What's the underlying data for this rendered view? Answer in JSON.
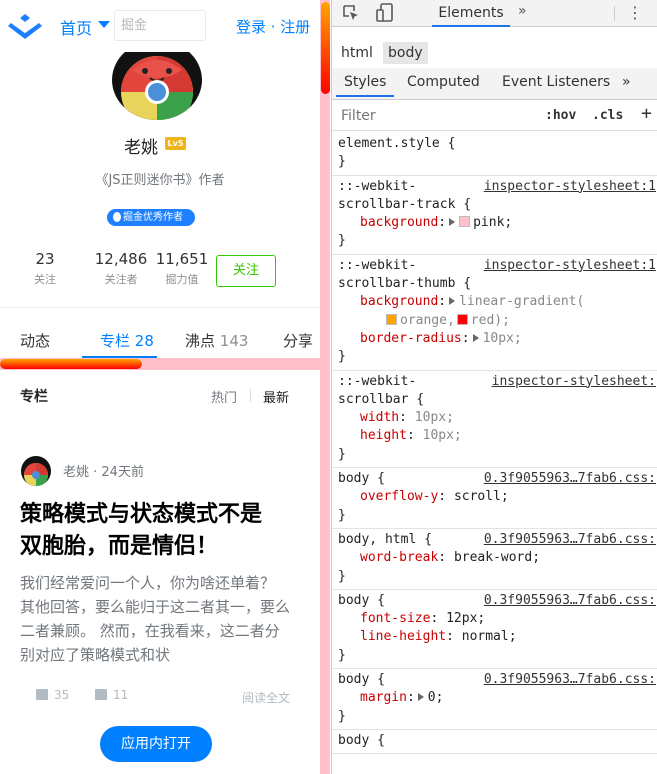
{
  "header": {
    "home_label": "首页",
    "search_placeholder": "掘金",
    "login_label": "登录 · 注册"
  },
  "profile": {
    "username": "老姚",
    "level": "Lv5",
    "bio": "《JS正则迷你书》作者",
    "badge": "掘金优秀作者",
    "stats": [
      {
        "number": "23",
        "label": "关注"
      },
      {
        "number": "12,486",
        "label": "关注者"
      },
      {
        "number": "11,651",
        "label": "掘力值"
      }
    ],
    "follow_label": "关注"
  },
  "tabs": [
    {
      "label": "动态",
      "count": ""
    },
    {
      "label": "专栏",
      "count": "28"
    },
    {
      "label": "沸点",
      "count": "143"
    },
    {
      "label": "分享",
      "count": ""
    }
  ],
  "section": {
    "title": "专栏",
    "sort_hot": "热门",
    "sort_new": "最新"
  },
  "article": {
    "author_meta": "老姚 · 24天前",
    "title": "策略模式与状态模式不是双胞胎，而是情侣！",
    "summary": "我们经常爱问一个人，你为啥还单着？ 其他回答，要么能归于这二者其一，要么二者兼顾。 然而，在我看来，这二者分别对应了策略模式和状",
    "likes": "35",
    "comments": "11",
    "read_more": "阅读全文",
    "open_app": "应用内打开"
  },
  "devtools": {
    "main_tab": "Elements",
    "more": "»",
    "menu": "⋮",
    "breadcrumbs": [
      "html",
      "body"
    ],
    "subtabs": [
      "Styles",
      "Computed",
      "Event Listeners",
      "»"
    ],
    "filter_placeholder": "Filter",
    "hov": ":hov",
    "cls": ".cls",
    "plus": "+",
    "rules": {
      "r0": {
        "sel1": "element.style {",
        "close": "}"
      },
      "r1": {
        "sel1": "::-webkit-",
        "sel2": "scrollbar-track {",
        "src": "inspector-stylesheet:1",
        "p1n": "background",
        "p1v": "pink;",
        "close": "}"
      },
      "r2": {
        "sel1": "::-webkit-",
        "sel2": "scrollbar-thumb {",
        "src": "inspector-stylesheet:1",
        "p1n": "background",
        "p1v": "linear-gradient(",
        "p1c1": "orange,",
        "p1c2": "red);",
        "p2n": "border-radius",
        "p2v": "10px;",
        "close": "}"
      },
      "r3": {
        "sel1": "::-webkit-",
        "sel2": "scrollbar {",
        "src": "inspector-stylesheet:",
        "p1n": "width",
        "p1v": "10px;",
        "p2n": "height",
        "p2v": "10px;",
        "close": "}"
      },
      "r4": {
        "sel1": "body {",
        "src": "0.3f9055963…7fab6.css:",
        "p1n": "overflow-y",
        "p1v": "scroll;",
        "close": "}"
      },
      "r5": {
        "sel1": "body, html {",
        "src": "0.3f9055963…7fab6.css:",
        "p1n": "word-break",
        "p1v": "break-word;",
        "close": "}"
      },
      "r6": {
        "sel1": "body {",
        "src": "0.3f9055963…7fab6.css:",
        "p1n": "font-size",
        "p1v": "12px;",
        "p2n": "line-height",
        "p2v": "normal;",
        "close": "}"
      },
      "r7": {
        "sel1": "body {",
        "src": "0.3f9055963…7fab6.css:",
        "p1n": "margin",
        "p1v": "0;",
        "close": "}"
      },
      "r8": {
        "sel1": "body {"
      }
    },
    "colors": {
      "pink": "#ffc0cb",
      "orange": "#ffa500",
      "red": "#ff0000"
    }
  },
  "colors": {
    "accent": "#007fff",
    "follow_green": "#37c700"
  }
}
